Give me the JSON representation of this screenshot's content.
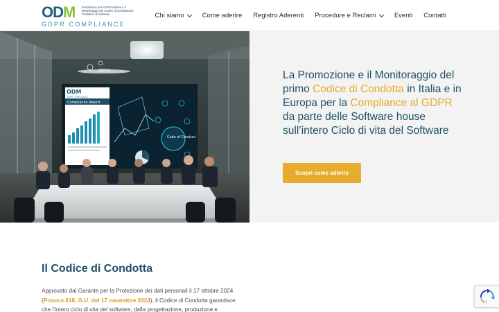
{
  "logo": {
    "odm_o": "O",
    "odm_d": "D",
    "odm_m": "M",
    "tagline": "Fondazione per la Promozione e il Monitoraggio del Codice di Condotta dei Produttori di Software",
    "subtitle": "GDPR COMPLIANCE"
  },
  "nav": {
    "items": [
      {
        "label": "Chi siamo",
        "dropdown": true
      },
      {
        "label": "Come aderire",
        "dropdown": false
      },
      {
        "label": "Registro Aderenti",
        "dropdown": false
      },
      {
        "label": "Procedure e Reclami",
        "dropdown": true
      },
      {
        "label": "Eventi",
        "dropdown": false
      },
      {
        "label": "Contatti",
        "dropdown": false
      }
    ]
  },
  "hero": {
    "image_text": {
      "sign": "ODM",
      "screen_title": "Compliance Report",
      "screen_logo": "ODM",
      "screen_logo_sub": "GDPR COMPLIANCE",
      "screen_center": "Code of Conduct"
    },
    "title_1": "La Promozione e il Monitoraggio del primo ",
    "title_hl1": "Codice di Condotta",
    "title_2": " in Italia e in Europa per la ",
    "title_hl2": "Compliance al GDPR",
    "title_3": " da parte delle Software house sull’intero Ciclo di vita del Software",
    "cta_label": "Scopri come aderire",
    "colors": {
      "accent": "#e7ab2e",
      "title": "#1f4f66",
      "panel": "#f3f3f3"
    }
  },
  "section": {
    "title": "Il Codice di Condotta",
    "text_1": "Approvato dal Garante per la Protezione dei dati personali il 17 ottobre 2024 (",
    "text_hl": "Provv.n.618, G.U. del 17 novembre 2024",
    "text_2": "), il Codice di Condotta garantisce che l’intero ciclo di vita del software, dalla progettazione, produzione e"
  }
}
